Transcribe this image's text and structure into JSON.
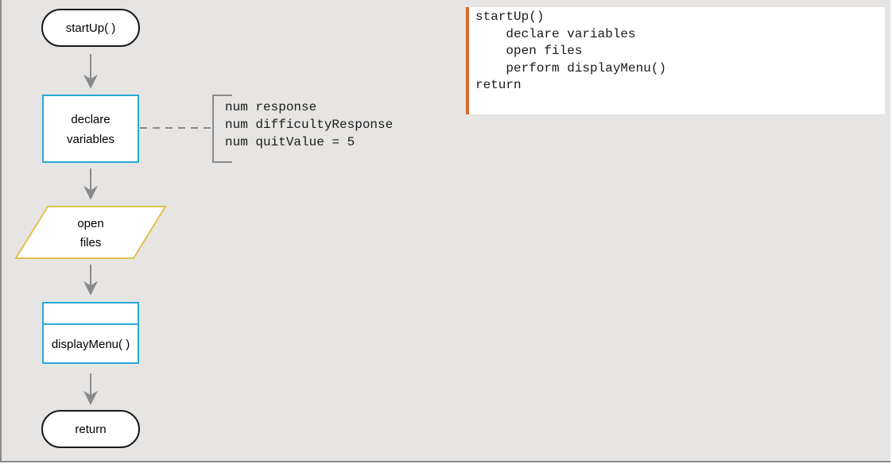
{
  "flowchart": {
    "start_label": "startUp( )",
    "declare_line1": "declare",
    "declare_line2": "variables",
    "open_line1": "open",
    "open_line2": "files",
    "module_label": "displayMenu( )",
    "return_label": "return"
  },
  "annotation": {
    "lines": [
      "num response",
      "num difficultyResponse",
      "num quitValue = 5"
    ]
  },
  "pseudocode": {
    "lines": [
      "startUp()",
      "    declare variables",
      "    open files",
      "    perform displayMenu()",
      "return"
    ]
  },
  "colors": {
    "background": "#e6e5e3",
    "process_border": "#2aa8d8",
    "io_border": "#e3c04e",
    "code_accent": "#d9682a",
    "arrow": "#8a8a8a"
  }
}
